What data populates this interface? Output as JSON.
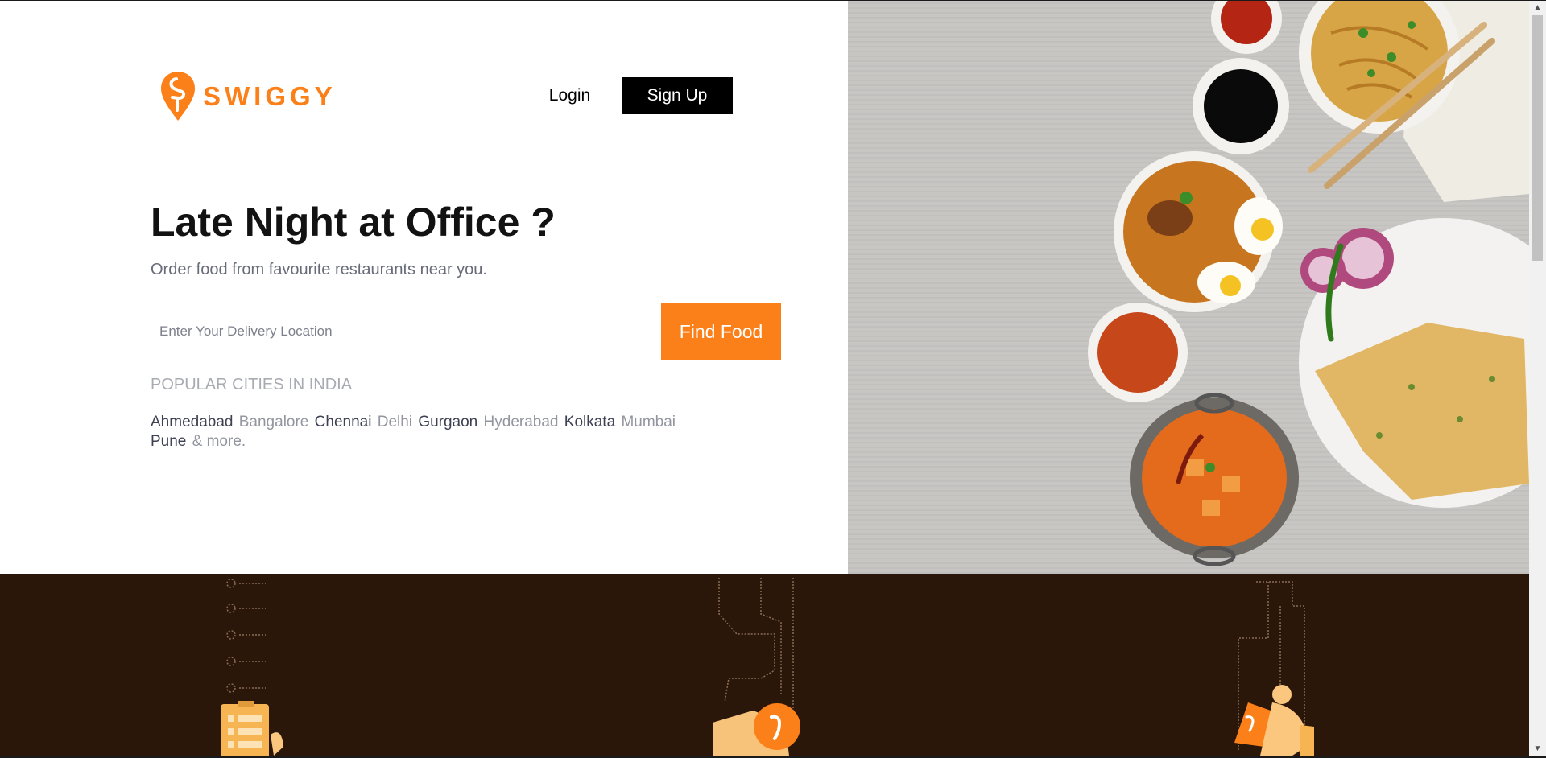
{
  "brand": {
    "name": "SWIGGY",
    "color": "#fc8019"
  },
  "header": {
    "login_label": "Login",
    "signup_label": "Sign Up"
  },
  "hero": {
    "headline": "Late Night at Office ?",
    "subheadline": "Order food from favourite restaurants near you.",
    "search": {
      "placeholder": "Enter Your Delivery Location",
      "value": "",
      "button_label": "Find Food"
    },
    "popular_label": "POPULAR CITIES IN INDIA",
    "cities": [
      "Ahmedabad",
      "Bangalore",
      "Chennai",
      "Delhi",
      "Gurgaon",
      "Hyderabad",
      "Kolkata",
      "Mumbai",
      "Pune"
    ],
    "more_label": "& more."
  },
  "icons": [
    "swiggy-logo-icon",
    "scroll-up-icon",
    "scroll-down-icon",
    "order-list-icon",
    "location-pin-icon",
    "delivery-rider-icon"
  ],
  "colors": {
    "accent": "#fc8019",
    "band": "#2b1709",
    "dark_text": "#3d4152",
    "light_text": "#93959f"
  }
}
